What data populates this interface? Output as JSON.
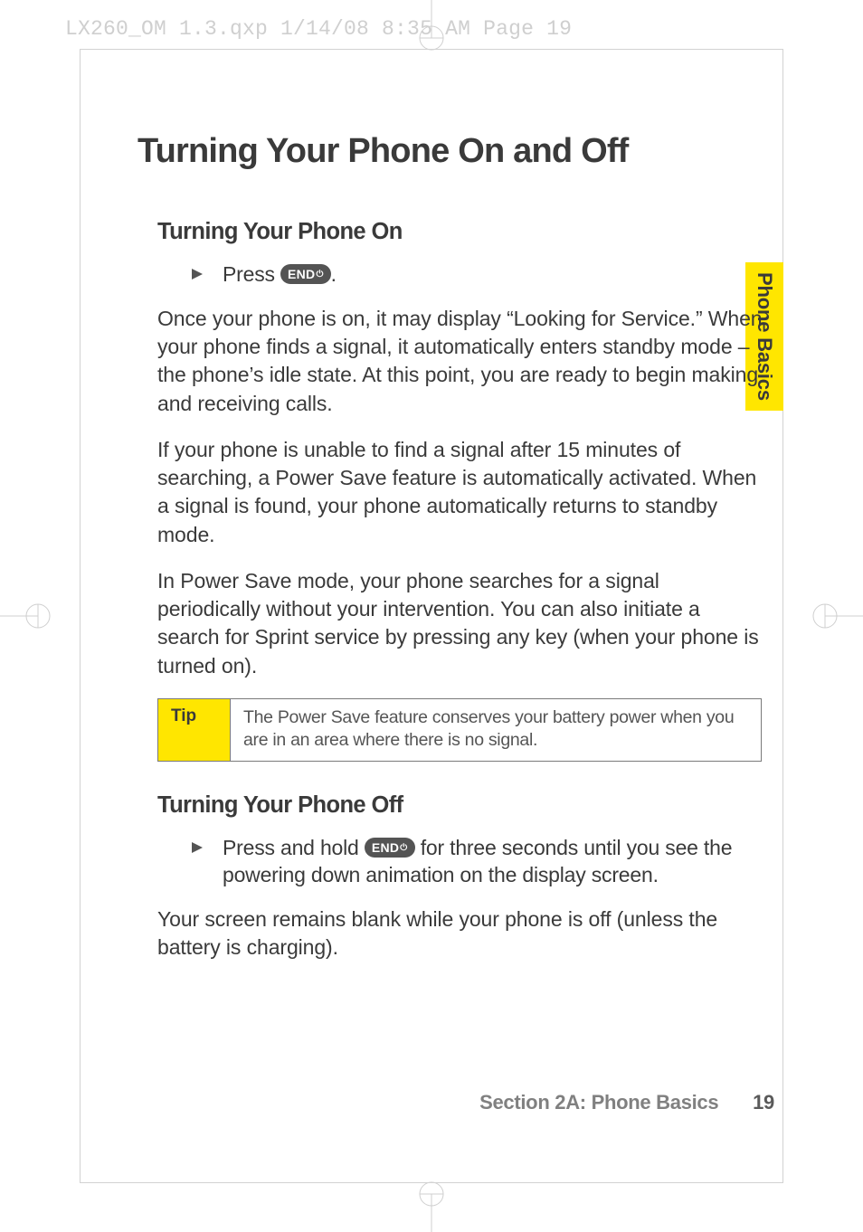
{
  "print_header": "LX260_OM 1.3.qxp  1/14/08  8:35 AM  Page 19",
  "side_tab": "Phone Basics",
  "heading": "Turning Your Phone On and Off",
  "section_on": {
    "title": "Turning Your Phone On",
    "bullet_pre": "Press ",
    "bullet_post": ".",
    "key_label": "END",
    "key_symbol": "⏻",
    "para1": "Once your phone is on, it may display “Looking for Service.” When your phone finds a signal, it automatically enters standby mode – the phone’s idle state. At this point, you are ready to begin making and receiving calls.",
    "para2": "If your phone is unable to find a signal after 15 minutes of searching, a Power Save feature is automatically activated. When a signal is found, your phone automatically returns to standby mode.",
    "para3": "In Power Save mode, your phone searches for a signal periodically without your intervention. You can also initiate a search for Sprint service by pressing any key (when your phone is turned on)."
  },
  "tip": {
    "label": "Tip",
    "text": "The Power Save feature conserves your battery power when you are in an area where there is no signal."
  },
  "section_off": {
    "title": "Turning Your Phone Off",
    "bullet_pre": "Press and hold ",
    "bullet_post": " for three seconds until you see the powering down animation on the display screen.",
    "key_label": "END",
    "key_symbol": "⏻",
    "para1": "Your screen remains blank while your phone is off (unless the battery is charging)."
  },
  "footer": {
    "section": "Section 2A: Phone Basics",
    "page": "19"
  }
}
